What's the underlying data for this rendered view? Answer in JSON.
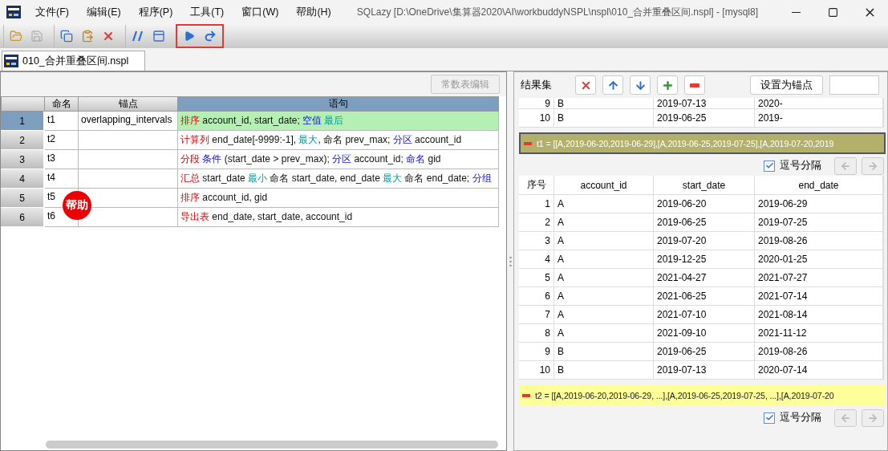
{
  "window": {
    "title": "SQLazy  [D:\\OneDrive\\集算器2020\\AI\\workbuddyNSPL\\nspl\\010_合并重叠区间.nspl] - [mysql8]"
  },
  "menu": [
    {
      "label": "文件(F)"
    },
    {
      "label": "编辑(E)"
    },
    {
      "label": "程序(P)"
    },
    {
      "label": "工具(T)"
    },
    {
      "label": "窗口(W)"
    },
    {
      "label": "帮助(H)"
    }
  ],
  "toolbar": [
    {
      "highlighted": false,
      "tools": [
        {
          "kind": "open",
          "disabled": false
        },
        {
          "kind": "save",
          "disabled": true
        }
      ]
    },
    {
      "highlighted": false,
      "tools": [
        {
          "kind": "copy",
          "disabled": false
        },
        {
          "kind": "paste",
          "disabled": false
        },
        {
          "kind": "delete",
          "disabled": false
        }
      ]
    },
    {
      "highlighted": false,
      "tools": [
        {
          "kind": "comment",
          "disabled": false
        },
        {
          "kind": "panel",
          "disabled": false
        }
      ]
    },
    {
      "highlighted": true,
      "tools": [
        {
          "kind": "run",
          "disabled": false
        },
        {
          "kind": "step",
          "disabled": false
        }
      ]
    }
  ],
  "tabs": [
    {
      "label": "010_合并重叠区间.nspl",
      "selected": true
    }
  ],
  "editor": {
    "constants_button": {
      "label": "常数表编辑",
      "disabled": true
    },
    "columns": [
      {
        "label": "命名",
        "selected": false
      },
      {
        "label": "锚点",
        "selected": false
      },
      {
        "label": "语句",
        "selected": true
      }
    ],
    "rows": [
      {
        "number": "1",
        "name": "t1",
        "anchor": "overlapping_intervals",
        "selected": true,
        "statement": [
          {
            "kind": "command",
            "text": "排序"
          },
          {
            "kind": "plain",
            "text": " account_id, start_date; "
          },
          {
            "kind": "option",
            "text": "空值"
          },
          {
            "kind": "function",
            "text": " 最后"
          }
        ]
      },
      {
        "number": "2",
        "name": "t2",
        "selected": false,
        "statement": [
          {
            "kind": "command",
            "text": "计算列"
          },
          {
            "kind": "plain",
            "text": " end_date[-9999:-1], "
          },
          {
            "kind": "function",
            "text": "最大"
          },
          {
            "kind": "plain",
            "text": ", 命名 prev_max; "
          },
          {
            "kind": "option",
            "text": "分区"
          },
          {
            "kind": "plain",
            "text": " account_id"
          }
        ]
      },
      {
        "number": "3",
        "name": "t3",
        "selected": false,
        "statement": [
          {
            "kind": "command",
            "text": "分段"
          },
          {
            "kind": "option",
            "text": " 条件"
          },
          {
            "kind": "plain",
            "text": " (start_date > prev_max); "
          },
          {
            "kind": "option",
            "text": "分区"
          },
          {
            "kind": "plain",
            "text": " account_id; "
          },
          {
            "kind": "option",
            "text": "命名"
          },
          {
            "kind": "plain",
            "text": " gid"
          }
        ]
      },
      {
        "number": "4",
        "name": "t4",
        "selected": false,
        "statement": [
          {
            "kind": "command",
            "text": "汇总"
          },
          {
            "kind": "plain",
            "text": " start_date "
          },
          {
            "kind": "function",
            "text": "最小"
          },
          {
            "kind": "plain",
            "text": " 命名 start_date, end_date "
          },
          {
            "kind": "function",
            "text": "最大"
          },
          {
            "kind": "plain",
            "text": " 命名 end_date; "
          },
          {
            "kind": "option",
            "text": "分组"
          }
        ]
      },
      {
        "number": "5",
        "name": "t5",
        "selected": false,
        "statement": [
          {
            "kind": "command",
            "text": "排序"
          },
          {
            "kind": "plain",
            "text": " account_id, gid"
          }
        ]
      },
      {
        "number": "6",
        "name": "t6",
        "selected": false,
        "statement": [
          {
            "kind": "command",
            "text": "导出表"
          },
          {
            "kind": "plain",
            "text": " end_date, start_date, account_id"
          }
        ]
      }
    ],
    "help_badge": "帮助"
  },
  "results": {
    "title": "结果集",
    "actions": [
      {
        "kind": "delete"
      },
      {
        "kind": "up"
      },
      {
        "kind": "down"
      },
      {
        "kind": "add"
      },
      {
        "kind": "remove"
      }
    ],
    "anchor_button": "设置为锚点",
    "prev_rows": [
      [
        "9",
        "B",
        "2019-07-13",
        "2020-"
      ],
      [
        "10",
        "B",
        "2019-06-25",
        "2019-"
      ]
    ],
    "sets": [
      {
        "kind": "olive",
        "expression": "t1 = [[A,2019-06-20,2019-06-29],[A,2019-06-25,2019-07-25],[A,2019-07-20,2019",
        "comma_separated": true,
        "separator_label": "逗号分隔",
        "columns": [
          "序号",
          "account_id",
          "start_date",
          "end_date"
        ],
        "rows": [
          [
            "1",
            "A",
            "2019-06-20",
            "2019-06-29"
          ],
          [
            "2",
            "A",
            "2019-06-25",
            "2019-07-25"
          ],
          [
            "3",
            "A",
            "2019-07-20",
            "2019-08-26"
          ],
          [
            "4",
            "A",
            "2019-12-25",
            "2020-01-25"
          ],
          [
            "5",
            "A",
            "2021-04-27",
            "2021-07-27"
          ],
          [
            "6",
            "A",
            "2021-06-25",
            "2021-07-14"
          ],
          [
            "7",
            "A",
            "2021-07-10",
            "2021-08-14"
          ],
          [
            "8",
            "A",
            "2021-09-10",
            "2021-11-12"
          ],
          [
            "9",
            "B",
            "2019-06-25",
            "2019-08-26"
          ],
          [
            "10",
            "B",
            "2019-07-13",
            "2020-07-14"
          ]
        ]
      },
      {
        "kind": "yellow",
        "expression": "t2 = [[A,2019-06-20,2019-06-29, ...],[A,2019-06-25,2019-07-25, ...],[A,2019-07-20",
        "comma_separated": true,
        "separator_label": "逗号分隔"
      }
    ]
  }
}
